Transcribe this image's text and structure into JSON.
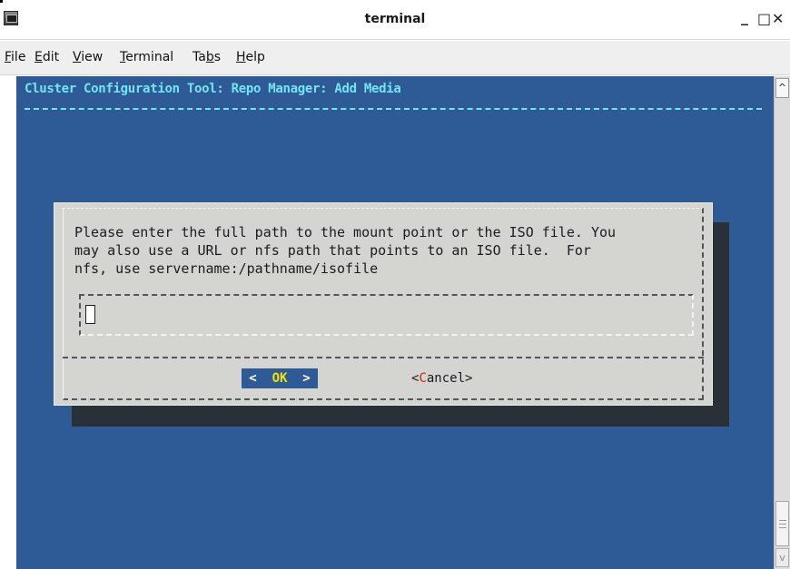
{
  "window": {
    "title": "terminal",
    "controls": {
      "minimize": "_",
      "maximize": "□",
      "close": "✕"
    }
  },
  "menu": {
    "items": [
      {
        "hotkey": "F",
        "rest": "ile"
      },
      {
        "hotkey": "E",
        "rest": "dit"
      },
      {
        "hotkey": "V",
        "rest": "iew"
      },
      {
        "hotkey": "T",
        "rest": "erminal"
      },
      {
        "pre": "Ta",
        "hotkey": "b",
        "rest": "s"
      },
      {
        "hotkey": "H",
        "rest": "elp"
      }
    ]
  },
  "terminal": {
    "header": "Cluster Configuration Tool: Repo Manager: Add Media",
    "background_color": "#2e5a96",
    "header_color": "#74e4f2"
  },
  "dialog": {
    "message_lines": [
      "Please enter the full path to the mount point or the ISO file. You",
      "may also use a URL or nfs path that points to an ISO file.  For",
      "nfs, use servername:/pathname/isofile"
    ],
    "input_value": "",
    "ok_button": {
      "left": "<  ",
      "hotkey": "OK",
      "right": "  >"
    },
    "cancel_button": {
      "left": "<",
      "hotkey": "C",
      "right": "ancel>"
    }
  },
  "scrollbar": {
    "up_arrow": "^",
    "down_arrow": "v"
  }
}
